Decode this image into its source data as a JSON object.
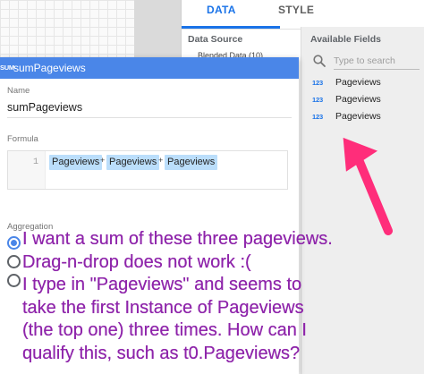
{
  "tabs": [
    {
      "label": "DATA",
      "active": true
    },
    {
      "label": "STYLE",
      "active": false
    }
  ],
  "data_source": {
    "label": "Data Source",
    "chip_text": "Blended Data (10)"
  },
  "available_fields": {
    "label": "Available Fields",
    "search_placeholder": "Type to search",
    "items": [
      {
        "type": "123",
        "name": "Pageviews"
      },
      {
        "type": "123",
        "name": "Pageviews"
      },
      {
        "type": "123",
        "name": "Pageviews"
      }
    ]
  },
  "dialog": {
    "type_icon": "SUM",
    "title": "sumPageviews",
    "name_label": "Name",
    "name_value": "sumPageviews",
    "formula_label": "Formula",
    "line_number": "1",
    "formula_tokens": [
      "Pageviews",
      "+",
      "Pageviews",
      "+",
      "Pageviews"
    ],
    "aggregation_label": "Aggregation"
  },
  "annotation": {
    "lines": [
      "I want a sum of these three pageviews.",
      "Drag-n-drop does not work :(",
      "I type in \"Pageviews\" and seems to",
      "take the first Instance of Pageviews",
      "(the top one) three times. How can I",
      "qualify this, such as t0.Pageviews?"
    ]
  },
  "colors": {
    "accent": "#1a73e8",
    "dialog_header": "#4a86e8",
    "token_bg": "#bbdefb",
    "annotation_text": "#8e24aa",
    "arrow": "#ff2d7a"
  }
}
